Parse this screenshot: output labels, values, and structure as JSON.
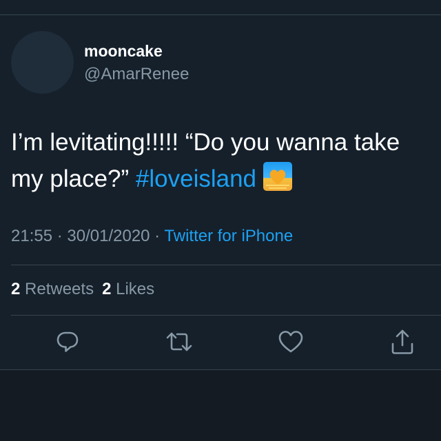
{
  "user": {
    "display_name": "mooncake",
    "handle": "@AmarRenee"
  },
  "tweet": {
    "text_line1": "I’m levitating!!!!! “Do you wanna take",
    "text_line2": "my place?” ",
    "hashtag": "#loveisland",
    "emoji_icon": "sunset-heart-emoji"
  },
  "meta": {
    "time": "21:55",
    "separator": " · ",
    "date": "30/01/2020",
    "source": "Twitter for iPhone"
  },
  "stats": {
    "retweets_count": "2",
    "retweets_label": "Retweets",
    "likes_count": "2",
    "likes_label": "Likes"
  },
  "actions": [
    "reply-icon",
    "retweet-icon",
    "like-icon",
    "share-icon"
  ],
  "colors": {
    "background": "#15202b",
    "accent": "#1da1f2",
    "secondary_text": "#8899a6",
    "divider": "#38444d"
  }
}
